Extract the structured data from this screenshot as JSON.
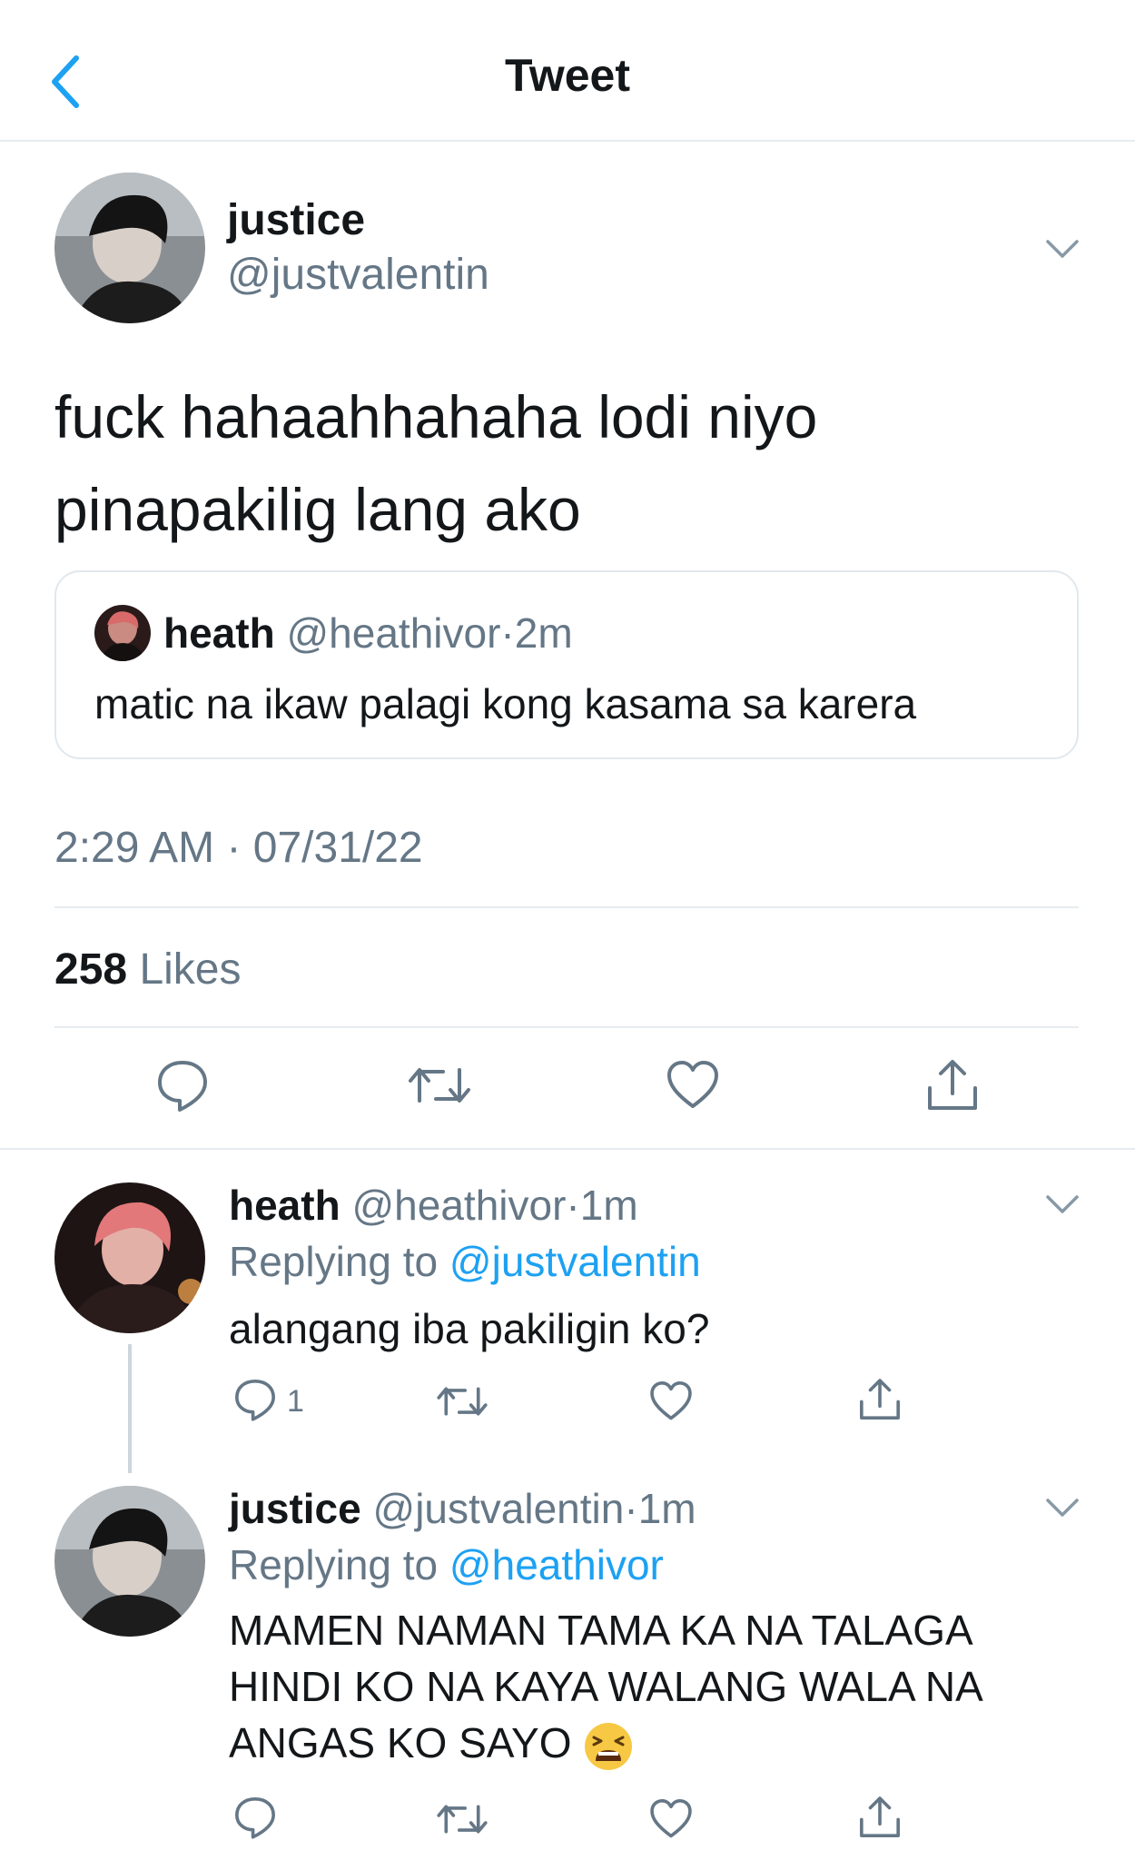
{
  "header": {
    "title": "Tweet"
  },
  "main_tweet": {
    "name": "justice",
    "handle": "@justvalentin",
    "text": "fuck hahaahhahaha lodi niyo pinapakilig lang ako",
    "quote": {
      "name": "heath",
      "handle": "@heathivor",
      "sep": "·",
      "time": "2m",
      "text": "matic na ikaw palagi kong kasama sa karera"
    },
    "timestamp": "2:29 AM · 07/31/22",
    "likes_count": "258",
    "likes_label": "Likes"
  },
  "replies": [
    {
      "name": "heath",
      "handle": "@heathivor",
      "sep": "·",
      "time": "1m",
      "replying_prefix": "Replying to ",
      "replying_to": "@justvalentin",
      "text": "alangang iba pakiligin ko?",
      "reply_count": "1"
    },
    {
      "name": "justice",
      "handle": "@justvalentin",
      "sep": "·",
      "time": "1m",
      "replying_prefix": "Replying to ",
      "replying_to": "@heathivor",
      "text_line1": "MAMEN NAMAN TAMA KA NA TALAGA",
      "text_line2": "HINDI KO NA KAYA WALANG WALA NA",
      "text_line3": "ANGAS KO SAYO",
      "emoji": "tired-face-emoji"
    }
  ],
  "colors": {
    "accent": "#1da1f2",
    "muted": "#657786",
    "text": "#14171a",
    "divider": "#e6ecf0"
  },
  "icons": {
    "back": "chevron-left-icon",
    "more": "chevron-down-icon",
    "reply": "comment-bubble-icon",
    "retweet": "retweet-icon",
    "like": "heart-icon",
    "share": "share-icon"
  }
}
